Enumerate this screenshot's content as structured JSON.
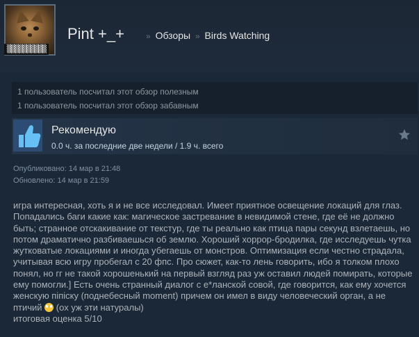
{
  "profile": {
    "name": "Pint +_+",
    "avatar_caption": "▒▒▒▒▒▒▒▒▒▒"
  },
  "breadcrumb": {
    "sep1": "»",
    "reviews": "Обзоры",
    "sep2": "»",
    "game": "Birds Watching"
  },
  "ratings": {
    "helpful": "1 пользователь посчитал этот обзор полезным",
    "funny": "1 пользователь посчитал этот обзор забавным"
  },
  "review": {
    "verdict": "Рекомендую",
    "hours": "0.0 ч. за последние две недели / 1.9 ч. всего",
    "icon": "thumbs-up-icon",
    "star_icon": "star-icon",
    "colors": {
      "header_bg": "#243447",
      "thumb_bg": "#2c4c73",
      "thumb_fg": "#66c0f4"
    }
  },
  "dates": {
    "published": "Опубликовано: 14 мар в 21:48",
    "updated": "Обновлено: 14 мар в 21:59"
  },
  "body": {
    "text_before_emoji": "игра интересная, хоть я и не все исследовал. Имеет приятное освещение локаций для глаз. Попадались баги какие как: магическое застревание в невидимой стене, где её не должно быть; странное отскакивание от текстур, где ты реально как птица пары секунд взлетаешь, но потом драматично разбиваешься об землю. Хороший хоррор-бродилка, где исследуешь чутка жутковатые локациями и иногда убегаешь от монстров. Оптимизация если честно страдала, учитывая всю игру пробегал с 20 фпс. Про сюжет, как-то лень говорить, ибо я толком плохо понял, но гг не такой хорошенький на первый взгляд раз уж оставил людей помирать, которые ему помогли.] Есть очень странный диалог с е*ланской совой, где говорится, как ему хочется женскую пiпiску (поднебесный moment) причем он имел в виду человеческий орган, а не птичий",
    "emoji_icon": "scream-emoji-icon",
    "text_after_emoji": " (ох уж эти натуралы)",
    "final_score": "итоговая оценка 5/10"
  }
}
